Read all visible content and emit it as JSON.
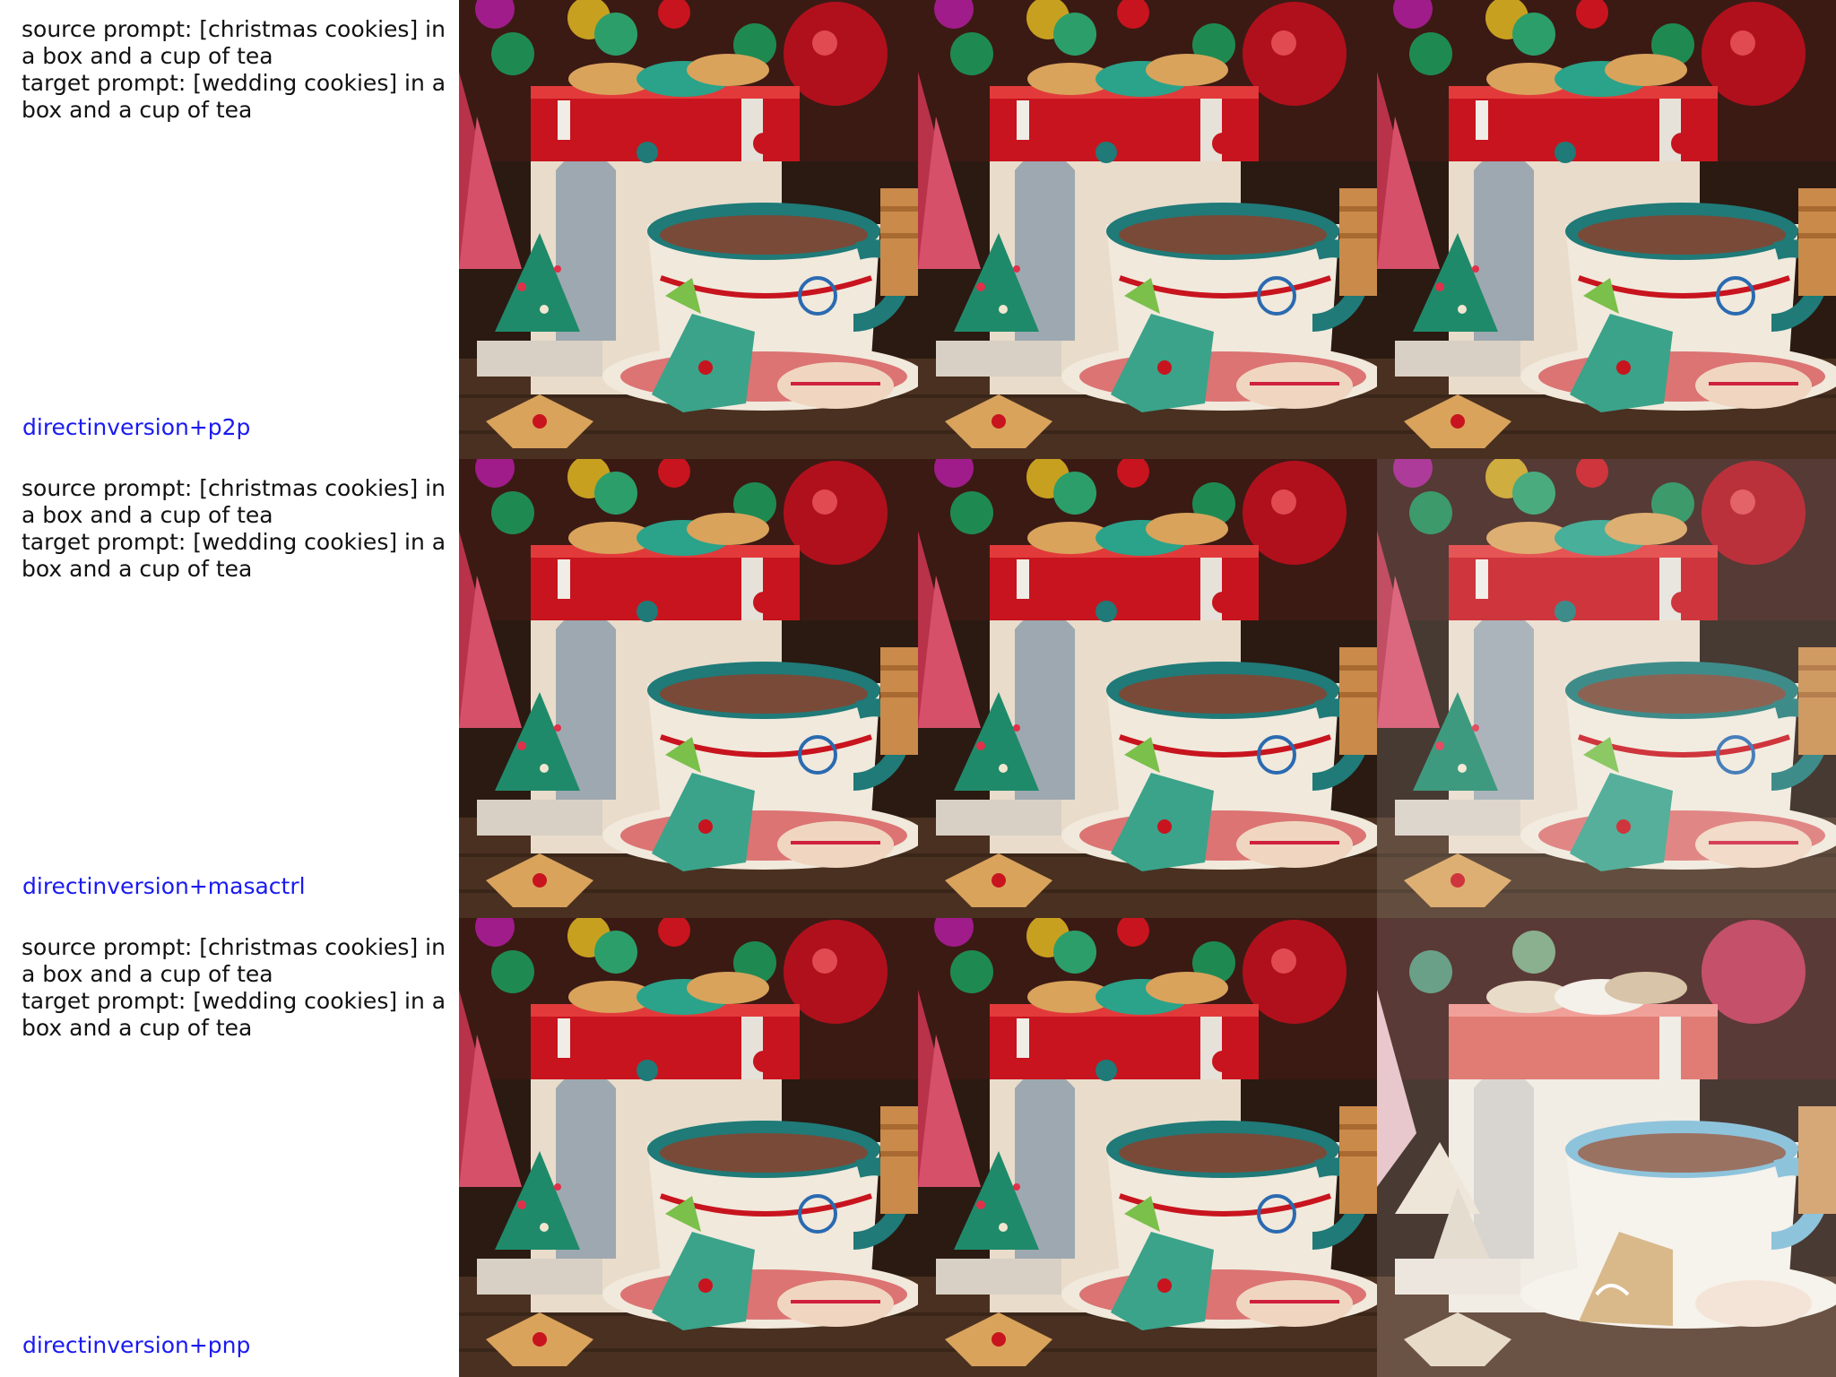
{
  "rows": [
    {
      "source_prompt": "source prompt: [christmas cookies] in a box and a cup of tea",
      "target_prompt": "target prompt: [wedding cookies] in a box and a cup of tea",
      "method": "directinversion+p2p",
      "method_color": "#1a1af0"
    },
    {
      "source_prompt": "source prompt: [christmas cookies] in a box and a cup of tea",
      "target_prompt": "target prompt: [wedding cookies] in a box and a cup of tea",
      "method": "directinversion+masactrl",
      "method_color": "#1a1af0"
    },
    {
      "source_prompt": "source prompt: [christmas cookies] in a box and a cup of tea",
      "target_prompt": "target prompt: [wedding cookies] in a box and a cup of tea",
      "method": "directinversion+pnp",
      "method_color": "#1a1af0"
    }
  ],
  "palette": {
    "box_red": "#c8141e",
    "tea_teal": "#1f7a78",
    "cookie_tan": "#d9a35c",
    "wood_dark": "#3a2618",
    "wedding_white": "#f1ece4",
    "wedding_blue": "#8ec3dc"
  }
}
